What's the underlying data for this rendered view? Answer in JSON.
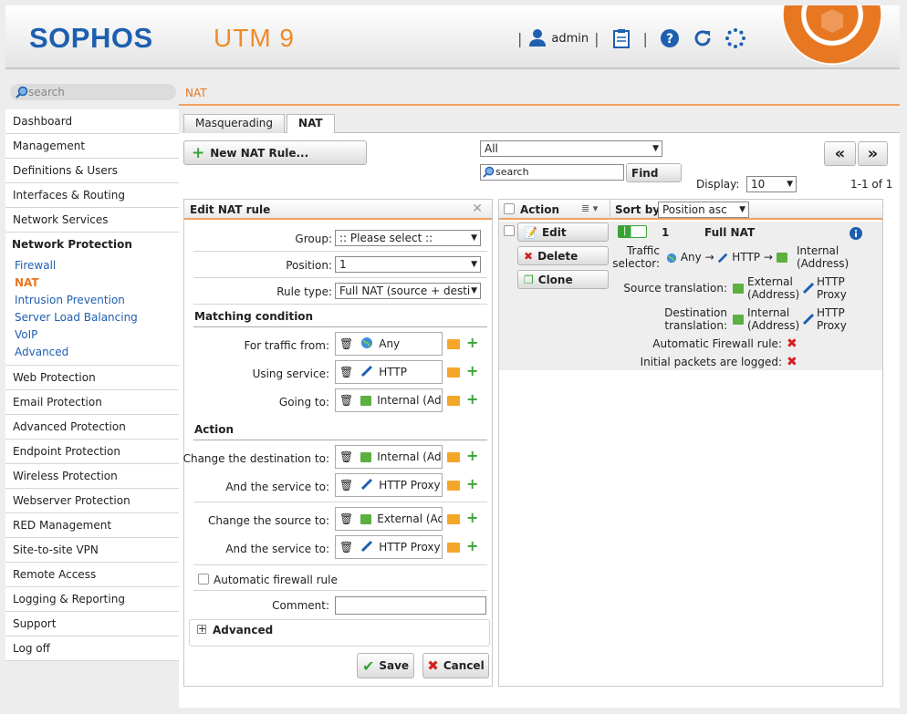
{
  "header": {
    "brand": "SOPHOS",
    "product": "UTM 9",
    "user": "admin"
  },
  "sidebar": {
    "search_placeholder": "search",
    "items_top": [
      "Dashboard",
      "Management",
      "Definitions & Users",
      "Interfaces & Routing",
      "Network Services"
    ],
    "group_title": "Network Protection",
    "group_items": [
      "Firewall",
      "NAT",
      "Intrusion Prevention",
      "Server Load Balancing",
      "VoIP",
      "Advanced"
    ],
    "active_item": "NAT",
    "items_bottom": [
      "Web Protection",
      "Email Protection",
      "Advanced Protection",
      "Endpoint Protection",
      "Wireless Protection",
      "Webserver Protection",
      "RED Management",
      "Site-to-site VPN",
      "Remote Access",
      "Logging & Reporting",
      "Support",
      "Log off"
    ]
  },
  "breadcrumb": "NAT",
  "tabs": [
    "Masquerading",
    "NAT"
  ],
  "active_tab": "NAT",
  "toolbar": {
    "new_rule": "New NAT Rule...",
    "filter_value": "All",
    "search_placeholder": "search",
    "find": "Find",
    "display_label": "Display:",
    "display_value": "10",
    "paging": "1-1 of 1",
    "prev": "«",
    "next": "»"
  },
  "edit": {
    "title": "Edit NAT rule",
    "group_label": "Group:",
    "group_value": ":: Please select ::",
    "position_label": "Position:",
    "position_value": "1",
    "ruletype_label": "Rule type:",
    "ruletype_value": "Full NAT (source + destin",
    "matching_title": "Matching condition",
    "from_label": "For traffic from:",
    "from_value": "Any",
    "service_label": "Using service:",
    "service_value": "HTTP",
    "to_label": "Going to:",
    "to_value": "Internal (Addr",
    "action_title": "Action",
    "chdst_label": "Change the destination to:",
    "chdst_value": "Internal (Addr",
    "dstsvc_label": "And the service to:",
    "dstsvc_value": "HTTP Proxy",
    "chsrc_label": "Change the source to:",
    "chsrc_value": "External (Add",
    "srcsvc_label": "And the service to:",
    "srcsvc_value": "HTTP Proxy",
    "autofw_label": "Automatic firewall rule",
    "comment_label": "Comment:",
    "advanced": "Advanced",
    "save": "Save",
    "cancel": "Cancel"
  },
  "list": {
    "action_header": "Action",
    "sortby_label": "Sort by:",
    "sortby_value": "Position asc",
    "rule": {
      "number": "1",
      "name": "Full NAT",
      "edit": "Edit",
      "delete": "Delete",
      "clone": "Clone",
      "traffic_selector_l1": "Traffic",
      "traffic_selector_l2": "selector:",
      "ts_any": "Any",
      "ts_http": "HTTP",
      "ts_internal_l1": "Internal",
      "ts_internal_l2": "(Address)",
      "src_trans_label": "Source translation:",
      "src_ext_l1": "External",
      "src_ext_l2": "(Address)",
      "src_http_l1": "HTTP",
      "src_http_l2": "Proxy",
      "dst_trans_l1": "Destination",
      "dst_trans_l2": "translation:",
      "dst_int_l1": "Internal",
      "dst_int_l2": "(Address)",
      "dst_http_l1": "HTTP",
      "dst_http_l2": "Proxy",
      "autofw_label": "Automatic Firewall rule:",
      "logged_label": "Initial packets are logged:",
      "arrow": "→"
    }
  },
  "colors": {
    "brand_blue": "#1d5fb0",
    "accent_orange": "#e87722",
    "ok_green": "#3aa335",
    "error_red": "#d62020"
  }
}
